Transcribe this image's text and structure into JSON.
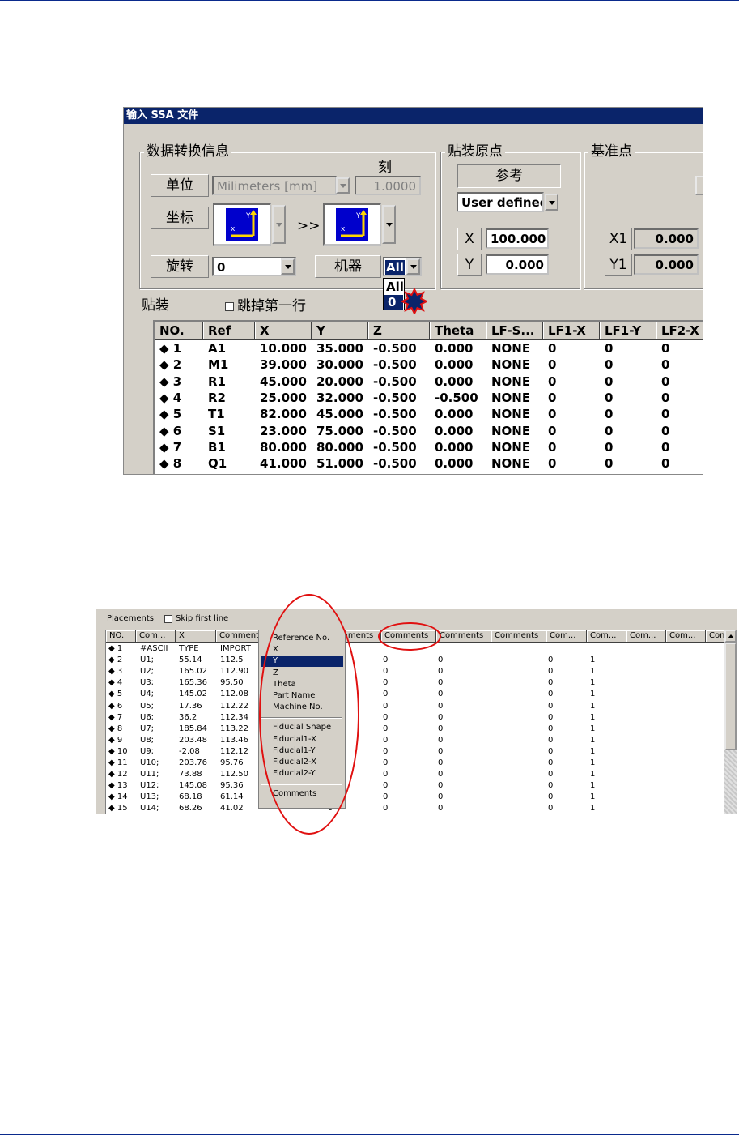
{
  "dialog1": {
    "title": "输入 SSA 文件",
    "data_group": {
      "title": "数据转换信息",
      "scale_label": "刻",
      "unit_label": "单位",
      "unit_value": "Milimeters [mm]",
      "scale_value": "1.0000",
      "coord_label": "坐标",
      "arrow": ">>",
      "rotation_label": "旋转",
      "rotation_value": "0",
      "machine_label": "机器",
      "machine_value": "All",
      "machine_options": [
        "All",
        "0"
      ]
    },
    "origin_group": {
      "title": "贴装原点",
      "ref_label": "参考",
      "ref_value": "User defined",
      "x_label": "X",
      "x_value": "100.000",
      "y_label": "Y",
      "y_value": "0.000"
    },
    "fiducial_group": {
      "title": "基准点",
      "x1_label": "X1",
      "x1_value": "0.000",
      "y1_label": "Y1",
      "y1_value": "0.000"
    },
    "placement_label": "贴装",
    "skip_first_label": "跳掉第一行",
    "table": {
      "headers": [
        "NO.",
        "Ref",
        "X",
        "Y",
        "Z",
        "Theta",
        "LF-S...",
        "LF1-X",
        "LF1-Y",
        "LF2-X"
      ],
      "rows": [
        [
          "◆ 1",
          "A1",
          "10.000",
          "35.000",
          "-0.500",
          "0.000",
          "NONE",
          "0",
          "0",
          "0"
        ],
        [
          "◆ 2",
          "M1",
          "39.000",
          "30.000",
          "-0.500",
          "0.000",
          "NONE",
          "0",
          "0",
          "0"
        ],
        [
          "◆ 3",
          "R1",
          "45.000",
          "20.000",
          "-0.500",
          "0.000",
          "NONE",
          "0",
          "0",
          "0"
        ],
        [
          "◆ 4",
          "R2",
          "25.000",
          "32.000",
          "-0.500",
          "-0.500",
          "NONE",
          "0",
          "0",
          "0"
        ],
        [
          "◆ 5",
          "T1",
          "82.000",
          "45.000",
          "-0.500",
          "0.000",
          "NONE",
          "0",
          "0",
          "0"
        ],
        [
          "◆ 6",
          "S1",
          "23.000",
          "75.000",
          "-0.500",
          "0.000",
          "NONE",
          "0",
          "0",
          "0"
        ],
        [
          "◆ 7",
          "B1",
          "80.000",
          "80.000",
          "-0.500",
          "0.000",
          "NONE",
          "0",
          "0",
          "0"
        ],
        [
          "◆ 8",
          "Q1",
          "41.000",
          "51.000",
          "-0.500",
          "0.000",
          "NONE",
          "0",
          "0",
          "0"
        ]
      ]
    }
  },
  "dialog2": {
    "placements_label": "Placements",
    "skip_first_label": "Skip first line",
    "headers": [
      "NO.",
      "Com...",
      "X",
      "Comments",
      "Comments",
      "Comments",
      "Comments",
      "Comments",
      "Comments",
      "Com...",
      "Com...",
      "Com...",
      "Com...",
      "Com"
    ],
    "rows": [
      [
        "◆ 1",
        "#ASCII",
        "TYPE",
        "IMPORT",
        "",
        "",
        "",
        "",
        ""
      ],
      [
        "◆ 2",
        "U1;",
        "55.14",
        "112.5",
        "0",
        "0",
        "0",
        "0",
        "1"
      ],
      [
        "◆ 3",
        "U2;",
        "165.02",
        "112.90",
        "0",
        "0",
        "0",
        "0",
        "1"
      ],
      [
        "◆ 4",
        "U3;",
        "165.36",
        "95.50",
        "0",
        "0",
        "0",
        "0",
        "1"
      ],
      [
        "◆ 5",
        "U4;",
        "145.02",
        "112.08",
        "0",
        "0",
        "0",
        "0",
        "1"
      ],
      [
        "◆ 6",
        "U5;",
        "17.36",
        "112.22",
        "0",
        "0",
        "0",
        "0",
        "1"
      ],
      [
        "◆ 7",
        "U6;",
        "36.2",
        "112.34",
        "0",
        "0",
        "0",
        "0",
        "1"
      ],
      [
        "◆ 8",
        "U7;",
        "185.84",
        "113.22",
        "0",
        "0",
        "0",
        "0",
        "1"
      ],
      [
        "◆ 9",
        "U8;",
        "203.48",
        "113.46",
        "0",
        "0",
        "0",
        "0",
        "1"
      ],
      [
        "◆ 10",
        "U9;",
        "-2.08",
        "112.12",
        "0",
        "0",
        "0",
        "0",
        "1"
      ],
      [
        "◆ 11",
        "U10;",
        "203.76",
        "95.76",
        "0",
        "0",
        "0",
        "0",
        "1"
      ],
      [
        "◆ 12",
        "U11;",
        "73.88",
        "112.50",
        "0",
        "0",
        "0",
        "0",
        "1"
      ],
      [
        "◆ 13",
        "U12;",
        "145.08",
        "95.36",
        "0",
        "0",
        "0",
        "0",
        "1"
      ],
      [
        "◆ 14",
        "U13;",
        "68.18",
        "61.14",
        "0",
        "0",
        "0",
        "0",
        "1"
      ],
      [
        "◆ 15",
        "U14;",
        "68.26",
        "41.02",
        "0",
        "0",
        "0",
        "0",
        "1"
      ]
    ],
    "menu": {
      "items_a": [
        "Reference No.",
        "X",
        "Y",
        "Z",
        "Theta",
        "Part Name",
        "Machine No."
      ],
      "items_b": [
        "Fiducial Shape",
        "Fiducial1-X",
        "Fiducial1-Y",
        "Fiducial2-X",
        "Fiducial2-Y"
      ],
      "items_c": [
        "Comments"
      ],
      "selected": "Y"
    }
  },
  "colors": {
    "accent_blue": "#0a246a",
    "annotation_red": "#e01010",
    "window_gray": "#d4d0c8"
  }
}
